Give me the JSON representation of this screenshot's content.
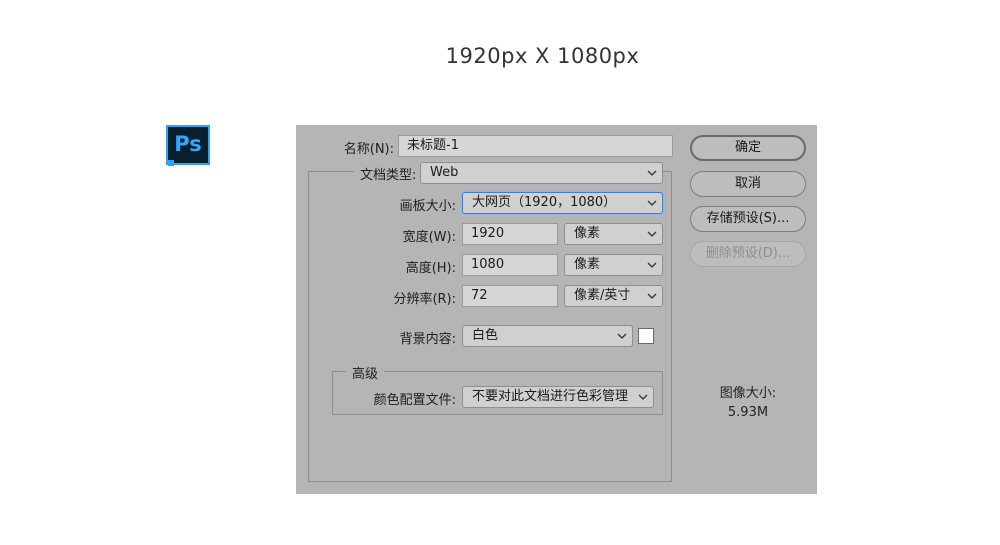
{
  "heading": "1920px X 1080px",
  "app_icon": {
    "text": "Ps",
    "icon": "photoshop-icon"
  },
  "dialog": {
    "name_label": "名称(N):",
    "name_value": "未标题-1",
    "doc_type_label": "文档类型:",
    "doc_type_value": "Web",
    "artboard_label": "画板大小:",
    "artboard_value": "大网页（1920，1080）",
    "width_label": "宽度(W):",
    "width_value": "1920",
    "width_unit": "像素",
    "height_label": "高度(H):",
    "height_value": "1080",
    "height_unit": "像素",
    "resolution_label": "分辨率(R):",
    "resolution_value": "72",
    "resolution_unit": "像素/英寸",
    "background_label": "背景内容:",
    "background_value": "白色",
    "background_swatch_color": "#ffffff",
    "advanced_title": "高级",
    "color_profile_label": "颜色配置文件:",
    "color_profile_value": "不要对此文档进行色彩管理",
    "buttons": {
      "ok": "确定",
      "cancel": "取消",
      "save_preset": "存储预设(S)...",
      "delete_preset": "删除预设(D)..."
    },
    "image_size_label": "图像大小:",
    "image_size_value": "5.93M"
  },
  "colors": {
    "dialog_bg": "#b5b5b5",
    "ps_blue": "#31a8ff",
    "ps_dark": "#0a1f2e"
  }
}
